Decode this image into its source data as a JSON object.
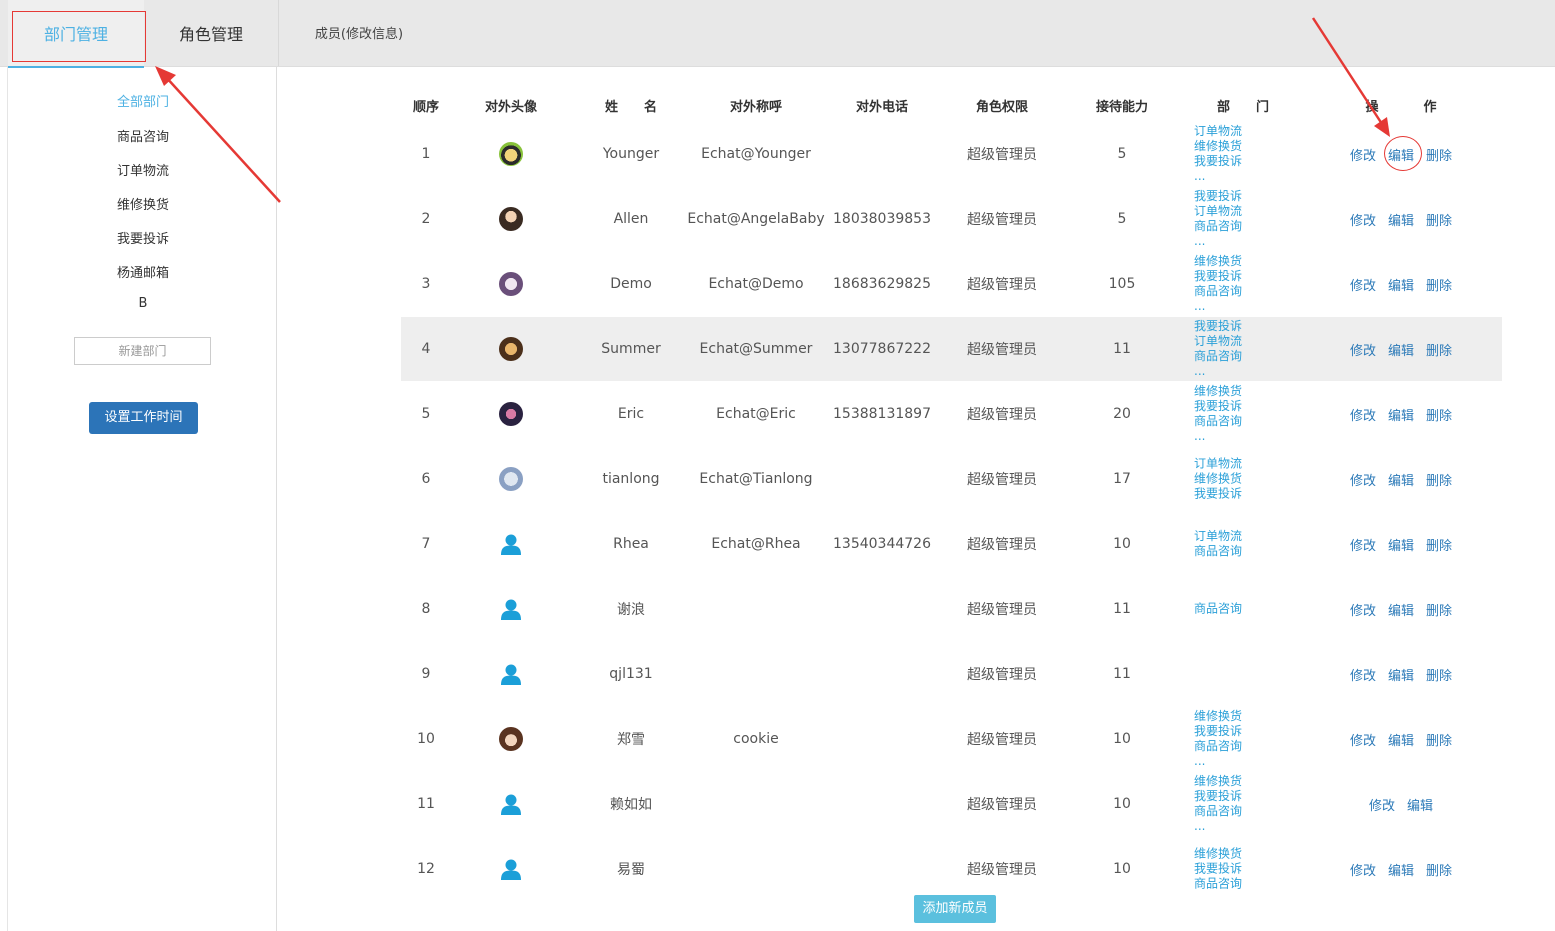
{
  "tabs": {
    "dept": "部门管理",
    "role": "角色管理",
    "member": "成员(修改信息)"
  },
  "sidebar": {
    "items": [
      "全部部门",
      "商品咨询",
      "订单物流",
      "维修换货",
      "我要投诉",
      "杨通邮箱",
      "B"
    ],
    "new_dept_placeholder": "新建部门",
    "work_time_button": "设置工作时间"
  },
  "table": {
    "headers": [
      "顺序",
      "对外头像",
      "姓　　名",
      "对外称呼",
      "对外电话",
      "角色权限",
      "接待能力",
      "部　　门",
      "操",
      "作"
    ],
    "rows": [
      {
        "order": "1",
        "avatar": "photo-avatar-1",
        "name": "Younger",
        "alias": "Echat@Younger",
        "phone": "",
        "role": "超级管理员",
        "capacity": "5",
        "depts": [
          "订单物流",
          "维修换货",
          "我要投诉",
          "..."
        ],
        "ops": [
          "修改",
          "编辑",
          "删除"
        ]
      },
      {
        "order": "2",
        "avatar": "photo-avatar-2",
        "name": "Allen",
        "alias": "Echat@AngelaBaby",
        "phone": "18038039853",
        "role": "超级管理员",
        "capacity": "5",
        "depts": [
          "我要投诉",
          "订单物流",
          "商品咨询",
          "..."
        ],
        "ops": [
          "修改",
          "编辑",
          "删除"
        ]
      },
      {
        "order": "3",
        "avatar": "photo-avatar-3",
        "name": "Demo",
        "alias": "Echat@Demo",
        "phone": "18683629825",
        "role": "超级管理员",
        "capacity": "105",
        "depts": [
          "维修换货",
          "我要投诉",
          "商品咨询",
          "..."
        ],
        "ops": [
          "修改",
          "编辑",
          "删除"
        ]
      },
      {
        "order": "4",
        "avatar": "photo-avatar-4",
        "name": "Summer",
        "alias": "Echat@Summer",
        "phone": "13077867222",
        "role": "超级管理员",
        "capacity": "11",
        "depts": [
          "我要投诉",
          "订单物流",
          "商品咨询",
          "..."
        ],
        "ops": [
          "修改",
          "编辑",
          "删除"
        ]
      },
      {
        "order": "5",
        "avatar": "photo-avatar-5",
        "name": "Eric",
        "alias": "Echat@Eric",
        "phone": "15388131897",
        "role": "超级管理员",
        "capacity": "20",
        "depts": [
          "维修换货",
          "我要投诉",
          "商品咨询",
          "..."
        ],
        "ops": [
          "修改",
          "编辑",
          "删除"
        ]
      },
      {
        "order": "6",
        "avatar": "photo-avatar-6",
        "name": "tianlong",
        "alias": "Echat@Tianlong",
        "phone": "",
        "role": "超级管理员",
        "capacity": "17",
        "depts": [
          "订单物流",
          "维修换货",
          "我要投诉"
        ],
        "ops": [
          "修改",
          "编辑",
          "删除"
        ]
      },
      {
        "order": "7",
        "avatar": "default-user-icon",
        "name": "Rhea",
        "alias": "Echat@Rhea",
        "phone": "13540344726",
        "role": "超级管理员",
        "capacity": "10",
        "depts": [
          "订单物流",
          "商品咨询"
        ],
        "ops": [
          "修改",
          "编辑",
          "删除"
        ]
      },
      {
        "order": "8",
        "avatar": "default-user-icon",
        "name": "谢浪",
        "alias": "",
        "phone": "",
        "role": "超级管理员",
        "capacity": "11",
        "depts": [
          "商品咨询"
        ],
        "ops": [
          "修改",
          "编辑",
          "删除"
        ]
      },
      {
        "order": "9",
        "avatar": "default-user-icon",
        "name": "qjl131",
        "alias": "",
        "phone": "",
        "role": "超级管理员",
        "capacity": "11",
        "depts": [],
        "ops": [
          "修改",
          "编辑",
          "删除"
        ]
      },
      {
        "order": "10",
        "avatar": "photo-avatar-10",
        "name": "郑雪",
        "alias": "cookie",
        "phone": "",
        "role": "超级管理员",
        "capacity": "10",
        "depts": [
          "维修换货",
          "我要投诉",
          "商品咨询",
          "..."
        ],
        "ops": [
          "修改",
          "编辑",
          "删除"
        ]
      },
      {
        "order": "11",
        "avatar": "default-user-icon",
        "name": "赖如如",
        "alias": "",
        "phone": "",
        "role": "超级管理员",
        "capacity": "10",
        "depts": [
          "维修换货",
          "我要投诉",
          "商品咨询",
          "..."
        ],
        "ops": [
          "修改",
          "编辑"
        ]
      },
      {
        "order": "12",
        "avatar": "default-user-icon",
        "name": "易蜀",
        "alias": "",
        "phone": "",
        "role": "超级管理员",
        "capacity": "10",
        "depts": [
          "维修换货",
          "我要投诉",
          "商品咨询"
        ],
        "ops": [
          "修改",
          "编辑",
          "删除"
        ]
      }
    ]
  },
  "add_member_button": "添加新成员",
  "colors": {
    "accent": "#4db1e3",
    "link": "#2c7ab8",
    "dept_link": "#2ba0d8",
    "primary_button": "#2c74b8",
    "add_button": "#5bc0de",
    "annotation": "#e53935",
    "highlight_row": "#eeeeee"
  }
}
